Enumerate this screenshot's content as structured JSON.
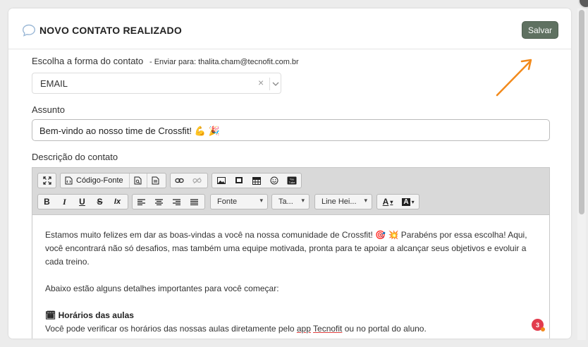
{
  "header": {
    "title": "NOVO CONTATO REALIZADO",
    "save_label": "Salvar"
  },
  "form": {
    "contact_label": "Escolha a forma do contato",
    "send_to": "- Enviar para: thalita.cham@tecnofit.com.br",
    "contact_value": "EMAIL",
    "clear_icon": "×",
    "subject_label": "Assunto",
    "subject_value": "Bem-vindo ao nosso time de Crossfit! 💪 🎉",
    "description_label": "Descrição do contato"
  },
  "toolbar": {
    "source_label": "Código-Fonte",
    "font_label": "Fonte",
    "size_label": "Ta...",
    "lineheight_label": "Line Hei...",
    "bold": "B",
    "italic": "I",
    "underline": "U",
    "strike": "S",
    "clear_format": "Ix",
    "font_color": "A",
    "bg_color": "A",
    "dropdown_caret": "▾"
  },
  "content": {
    "p1": "Estamos muito felizes em dar as boas-vindas a você na nossa comunidade de Crossfit! 🎯 💥 Parabéns por essa escolha! Aqui, você encontrará não só desafios, mas também uma equipe motivada, pronta para te apoiar a alcançar seus objetivos e evoluir a cada treino.",
    "p2": "Abaixo estão alguns detalhes importantes para você começar:",
    "h1_icon": "🗓",
    "h1": "Horários das aulas",
    "p3_a": "Você pode verificar os horários das nossas aulas diretamente pelo ",
    "p3_link": "app",
    "p3_b": " ",
    "p3_brand": "Tecnofit",
    "p3_c": " ou no portal do aluno."
  },
  "notification": {
    "count": "3"
  },
  "colors": {
    "accent": "#5f7161",
    "arrow": "#f28a1c",
    "badge": "#e23c4d"
  }
}
